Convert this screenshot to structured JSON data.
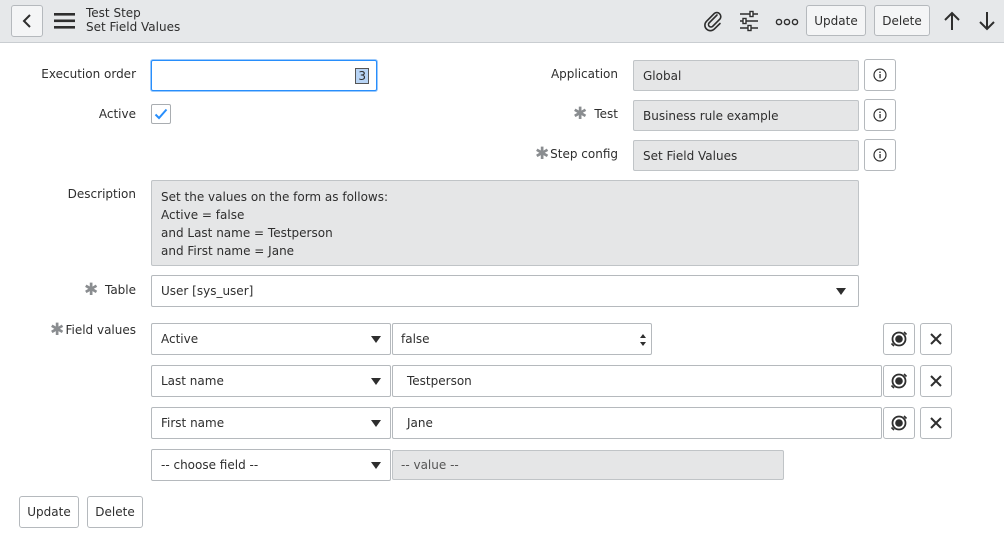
{
  "header": {
    "title": "Test Step",
    "subtitle": "Set Field Values",
    "update_label": "Update",
    "delete_label": "Delete"
  },
  "form": {
    "execution_order": {
      "label": "Execution order",
      "value": "3"
    },
    "active": {
      "label": "Active",
      "checked": true
    },
    "application": {
      "label": "Application",
      "value": "Global"
    },
    "test": {
      "label": "Test",
      "value": "Business rule example"
    },
    "step_config": {
      "label": "Step config",
      "value": "Set Field Values"
    },
    "description": {
      "label": "Description",
      "lines": [
        "Set the values on the form as follows:",
        "Active = false",
        "and Last name = Testperson",
        "and First name = Jane"
      ]
    },
    "table": {
      "label": "Table",
      "value": "User [sys_user]"
    },
    "field_values": {
      "label": "Field values",
      "rows": [
        {
          "field": "Active",
          "value": "false"
        },
        {
          "field": "Last name",
          "value": "Testperson"
        },
        {
          "field": "First name",
          "value": "Jane"
        }
      ],
      "new_row": {
        "field_placeholder": "-- choose field --",
        "value_placeholder": "-- value --"
      }
    }
  },
  "footer": {
    "update_label": "Update",
    "delete_label": "Delete"
  },
  "colors": {
    "header_bg": "#e6e8ea",
    "accent": "#278efc",
    "readonly_bg": "#e5e6e7"
  }
}
